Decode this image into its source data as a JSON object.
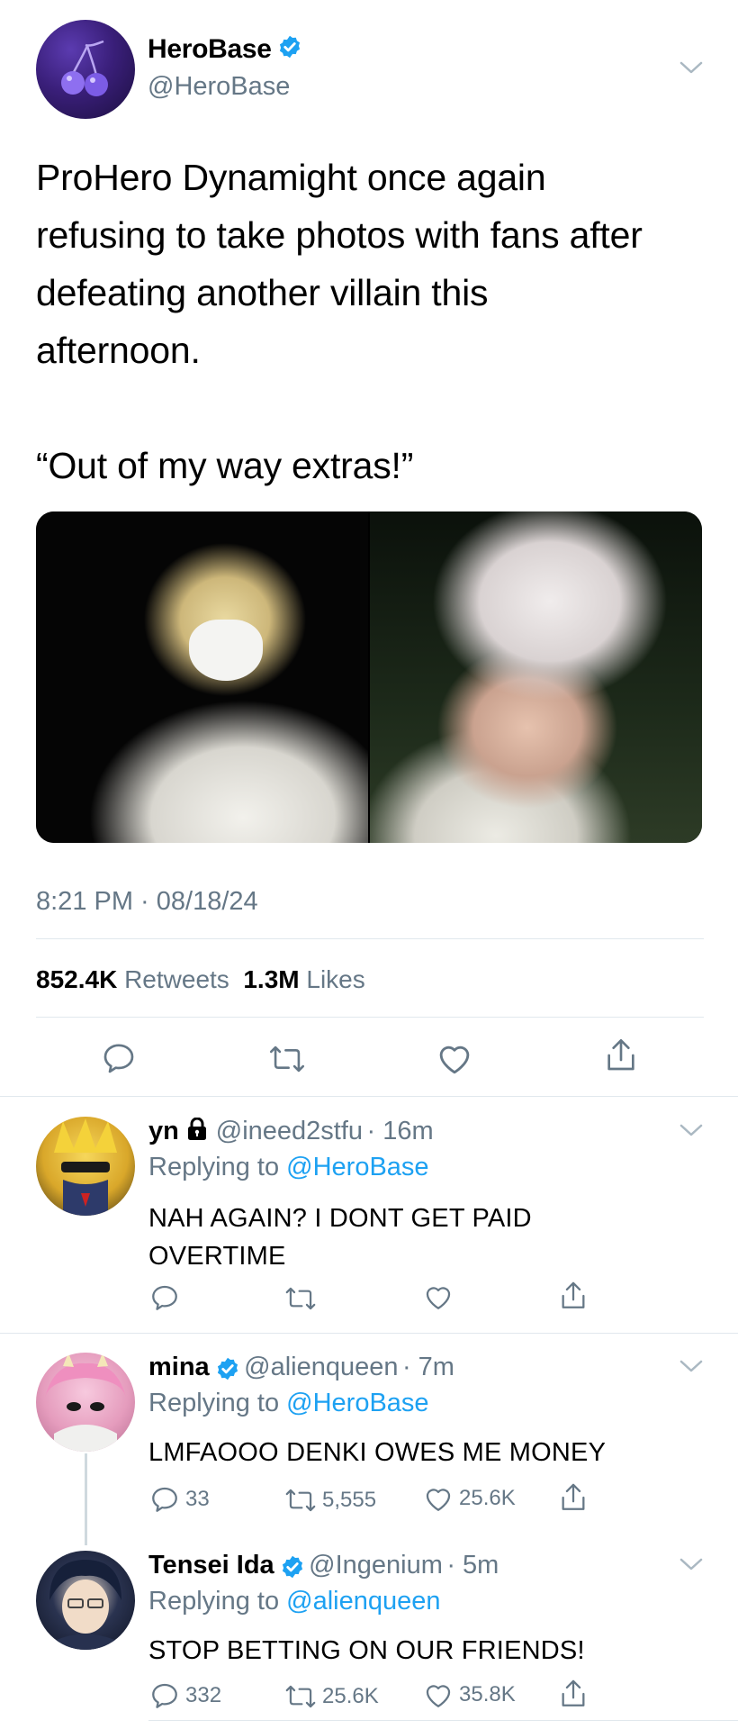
{
  "main_tweet": {
    "display_name": "HeroBase",
    "handle": "@HeroBase",
    "text_lines": [
      "ProHero Dynamight once again",
      "refusing to take photos with fans after",
      "defeating another villain this",
      "afternoon."
    ],
    "quote_line": "“Out of my way extras!”",
    "timestamp": "8:21 PM · 08/18/24",
    "retweets_count": "852.4K",
    "retweets_label": "Retweets",
    "likes_count": "1.3M",
    "likes_label": "Likes"
  },
  "replies": [
    {
      "display_name": "yn",
      "handle": "@ineed2stfu",
      "time": "· 16m",
      "replying_prefix": "Replying to",
      "replying_to": "@HeroBase",
      "text_lines": [
        "NAH AGAIN? I DONT GET PAID",
        "OVERTIME"
      ],
      "reply_count": "",
      "retweet_count": "",
      "like_count": ""
    },
    {
      "display_name": "mina",
      "handle": "@alienqueen",
      "time": "· 7m",
      "replying_prefix": "Replying to",
      "replying_to": "@HeroBase",
      "text_lines": [
        "LMFAOOO DENKI OWES ME MONEY"
      ],
      "reply_count": "33",
      "retweet_count": "5,555",
      "like_count": "25.6K"
    },
    {
      "display_name": "Tensei Ida",
      "handle": "@Ingenium",
      "time": "· 5m",
      "replying_prefix": "Replying to",
      "replying_to": "@alienqueen",
      "text_lines": [
        "STOP BETTING ON OUR FRIENDS!"
      ],
      "reply_count": "332",
      "retweet_count": "25.6K",
      "like_count": "35.8K"
    }
  ],
  "colors": {
    "accent": "#1da1f2",
    "muted": "#657786",
    "divider": "#e1e8ed"
  },
  "icons": [
    "verified-badge-icon",
    "chevron-down-icon",
    "reply-icon",
    "retweet-icon",
    "like-icon",
    "share-icon",
    "lock-icon"
  ]
}
